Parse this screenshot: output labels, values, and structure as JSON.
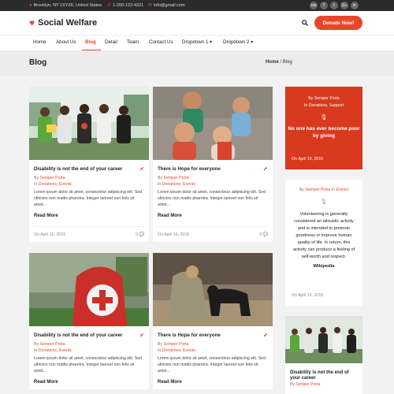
{
  "topbar": {
    "address": "Brooklyn, NY 1XYZ6, United States",
    "phone": "1-200-123-4321",
    "email": "info@gmail.com",
    "social": [
      "rss",
      "f",
      "t",
      "G+",
      "in"
    ]
  },
  "header": {
    "site_name": "Social Welfare",
    "donate_label": "Donate Now!"
  },
  "nav": {
    "items": [
      "Home",
      "About Us",
      "Blog",
      "Detail",
      "Team",
      "Contact Us",
      "Dropdown 1 ▾",
      "Dropdown 2 ▾"
    ],
    "active": "Blog"
  },
  "page": {
    "title": "Blog",
    "breadcrumb_home": "Home",
    "breadcrumb_sep": " / ",
    "breadcrumb_current": "Blog"
  },
  "posts": [
    {
      "title": "Disability is not the end of your career",
      "by": "By ",
      "author": "Semper Porta",
      "in": "In ",
      "categories": "Donations, Events",
      "excerpt": "Lorem ipsum dolor sit amet, consectetur adipiscing elit. Sed ultricies non mattis pharetra. Integer laoreet non felis sit amet...",
      "read_more": "Read More",
      "date": "On April 15, 2015",
      "comments": "0"
    },
    {
      "title": "There is Hope for everyone",
      "by": "By ",
      "author": "Semper Porta",
      "in": "In ",
      "categories": "Donations, Events",
      "excerpt": "Lorem ipsum dolor sit amet, consectetur adipiscing elit. Sed ultricies non mattis pharetra. Integer laoreet non felis sit amet...",
      "read_more": "Read More",
      "date": "On April 15, 2015",
      "comments": "0"
    },
    {
      "title": "Disability is not the end of your career",
      "by": "By ",
      "author": "Semper Porta",
      "in": "In ",
      "categories": "Donations, Events",
      "excerpt": "Lorem ipsum dolor sit amet, consectetur adipiscing elit. Sed ultricies non mattis pharetra. Integer laoreet non felis sit amet...",
      "read_more": "Read More"
    },
    {
      "title": "There is Hope for everyone",
      "by": "By ",
      "author": "Semper Porta",
      "in": "In ",
      "categories": "Donations, Events",
      "excerpt": "Lorem ipsum dolor sit amet, consectetur adipiscing elit. Sed ultricies non mattis pharetra. Integer laoreet non felis sit amet...",
      "read_more": "Read More"
    }
  ],
  "sidebar": {
    "quote1": {
      "by": "By Semper Porta",
      "in": "In Donations, Support",
      "text": "No one has ever become poor by giving",
      "date": "On April 15, 2015"
    },
    "quote2": {
      "by": "By ",
      "author": "Semper Porta",
      "in": " In ",
      "category": "Events",
      "text": "Volunteering is generally considered an altruistic activity and is intended to promote goodness or improve human quality of life. In return, this activity can produce a feeling of self-worth and respect.",
      "source": "Wikipedia",
      "date": "On April 15, 2015"
    },
    "post": {
      "title": "Disability is not the end of your career",
      "by": "By ",
      "author": "Semper Porta"
    }
  },
  "colors": {
    "accent": "#e8472a",
    "dark": "#2b2b2b"
  }
}
